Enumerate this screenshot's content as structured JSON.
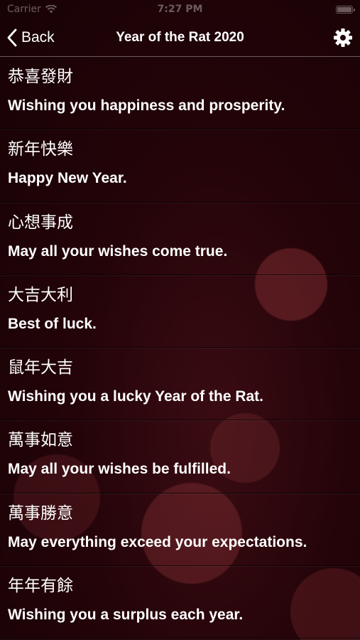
{
  "status_bar": {
    "carrier": "Carrier",
    "time": "7:27 PM"
  },
  "nav": {
    "back_label": "Back",
    "title": "Year of the Rat 2020",
    "back_icon": "chevron-left-icon",
    "settings_icon": "gear-icon"
  },
  "greetings": [
    {
      "chinese": "恭喜發財",
      "english": "Wishing you happiness and prosperity."
    },
    {
      "chinese": "新年快樂",
      "english": "Happy New Year."
    },
    {
      "chinese": "心想事成",
      "english": "May all your wishes come true."
    },
    {
      "chinese": "大吉大利",
      "english": "Best of luck."
    },
    {
      "chinese": "鼠年大吉",
      "english": "Wishing you a lucky Year of the Rat."
    },
    {
      "chinese": "萬事如意",
      "english": "May all your wishes be fulfilled."
    },
    {
      "chinese": "萬事勝意",
      "english": "May everything exceed your expectations."
    },
    {
      "chinese": "年年有餘",
      "english": "Wishing you a surplus each year."
    }
  ],
  "colors": {
    "background": "#240409",
    "text": "#ffffff"
  }
}
